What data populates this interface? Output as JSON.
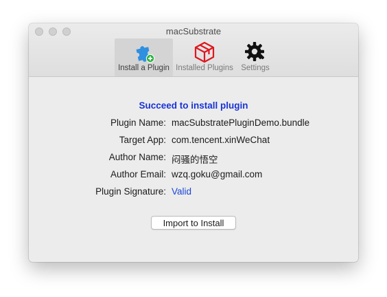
{
  "window": {
    "title": "macSubstrate"
  },
  "toolbar": {
    "items": [
      {
        "label": "Install a Plugin",
        "icon": "puzzle-add-icon",
        "selected": true
      },
      {
        "label": "Installed Plugins",
        "icon": "box-icon",
        "selected": false
      },
      {
        "label": "Settings",
        "icon": "gear-wrench-icon",
        "selected": false
      }
    ]
  },
  "result": {
    "headline": "Succeed to install plugin",
    "fields": [
      {
        "label": "Plugin Name:",
        "value": "macSubstratePluginDemo.bundle"
      },
      {
        "label": "Target App:",
        "value": "com.tencent.xinWeChat"
      },
      {
        "label": "Author Name:",
        "value": "闷骚的悟空"
      },
      {
        "label": "Author Email:",
        "value": "wzq.goku@gmail.com"
      },
      {
        "label": "Plugin Signature:",
        "value": "Valid"
      }
    ]
  },
  "actions": {
    "import_label": "Import to Install"
  },
  "colors": {
    "headline": "#1833d6",
    "link_value": "#1a45d6",
    "puzzle": "#2f8fe0",
    "badge": "#27b43c",
    "box": "#e0161f",
    "gear": "#111111"
  }
}
